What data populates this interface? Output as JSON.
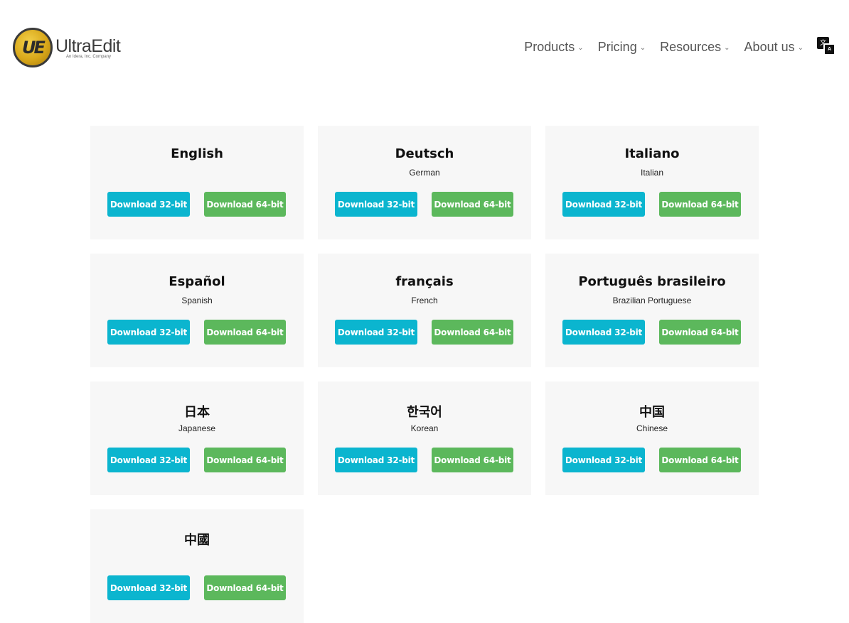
{
  "brand": {
    "name": "UltraEdit",
    "tagline": "An Idera, Inc. Company",
    "mark": "UE"
  },
  "nav": {
    "items": [
      {
        "label": "Products"
      },
      {
        "label": "Pricing"
      },
      {
        "label": "Resources"
      },
      {
        "label": "About us"
      }
    ],
    "chevron_icon": "chevron-down-icon",
    "translate_icon": "translate-icon",
    "translate_glyph_1": "文",
    "translate_glyph_2": "A"
  },
  "downloads": {
    "btn32_label": "Download 32-bit",
    "btn64_label": "Download 64-bit",
    "colors": {
      "btn32": "#0bb5cf",
      "btn64": "#5cb85c",
      "card_bg": "#f7f7f7"
    },
    "languages": [
      {
        "name": "English",
        "subtitle": ""
      },
      {
        "name": "Deutsch",
        "subtitle": "German"
      },
      {
        "name": "Italiano",
        "subtitle": "Italian"
      },
      {
        "name": "Español",
        "subtitle": "Spanish"
      },
      {
        "name": "français",
        "subtitle": "French"
      },
      {
        "name": "Português brasileiro",
        "subtitle": "Brazilian Portuguese"
      },
      {
        "name": "日本",
        "subtitle": "Japanese"
      },
      {
        "name": "한국어",
        "subtitle": "Korean"
      },
      {
        "name": "中国",
        "subtitle": "Chinese"
      },
      {
        "name": "中國",
        "subtitle": ""
      }
    ]
  }
}
